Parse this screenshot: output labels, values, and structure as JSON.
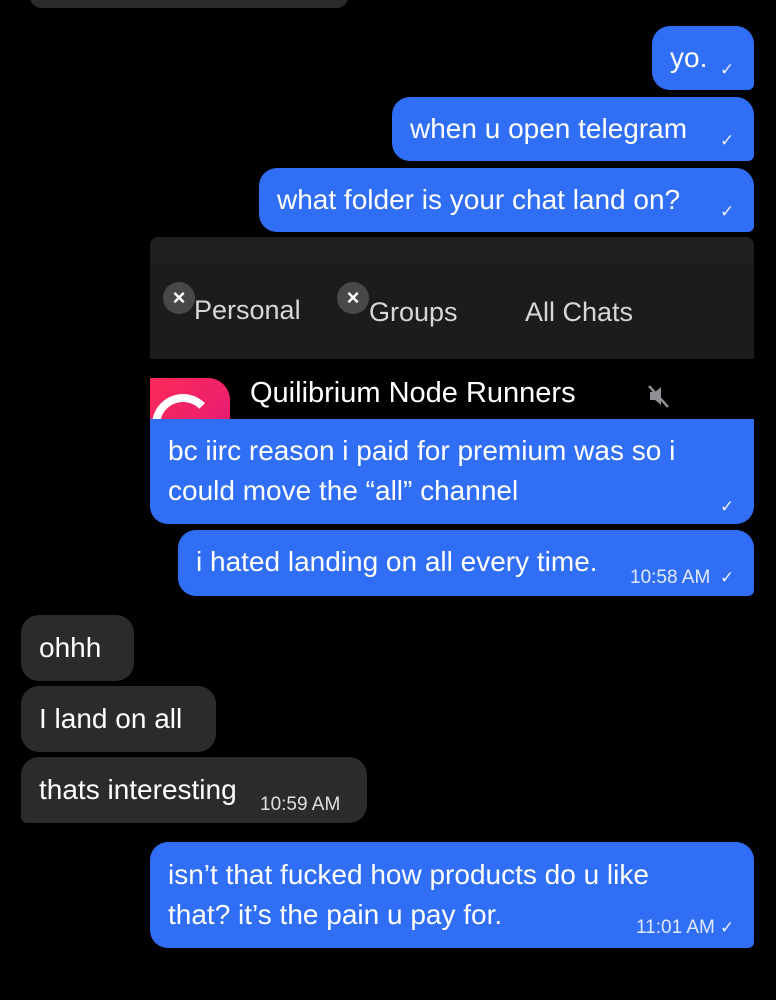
{
  "messages": {
    "m1": {
      "text": "yo.",
      "check": "✓"
    },
    "m2": {
      "text": "when u open telegram",
      "check": "✓"
    },
    "m3": {
      "text": "what folder is your chat land on?",
      "check": "✓"
    },
    "m4": {
      "line1": "bc iirc reason i paid for premium was so i",
      "line2": "could move the “all” channel",
      "check": "✓"
    },
    "m5": {
      "text": "i hated landing on all every time.",
      "time": "10:58 AM",
      "check": "✓"
    },
    "m6": {
      "text": "ohhh"
    },
    "m7": {
      "text": "I land on all"
    },
    "m8": {
      "text": "thats interesting",
      "time": "10:59 AM"
    },
    "m9": {
      "line1": "isn’t that fucked how products do u like",
      "line2": "that? it’s the pain u pay for.",
      "time": "11:01 AM",
      "check": "✓"
    }
  },
  "embedded_screenshot": {
    "tabs": [
      {
        "label": "Personal",
        "close": "×"
      },
      {
        "label": "Groups",
        "close": "×"
      },
      {
        "label": "All Chats"
      }
    ],
    "channel_name": "Quilibrium Node Runners",
    "colors": {
      "icon_gradient_start": "#ff2d55",
      "icon_gradient_end": "#e0177a"
    }
  },
  "colors": {
    "outgoing": "#2f6ef5",
    "incoming": "#2b2b2d",
    "background": "#000000"
  }
}
